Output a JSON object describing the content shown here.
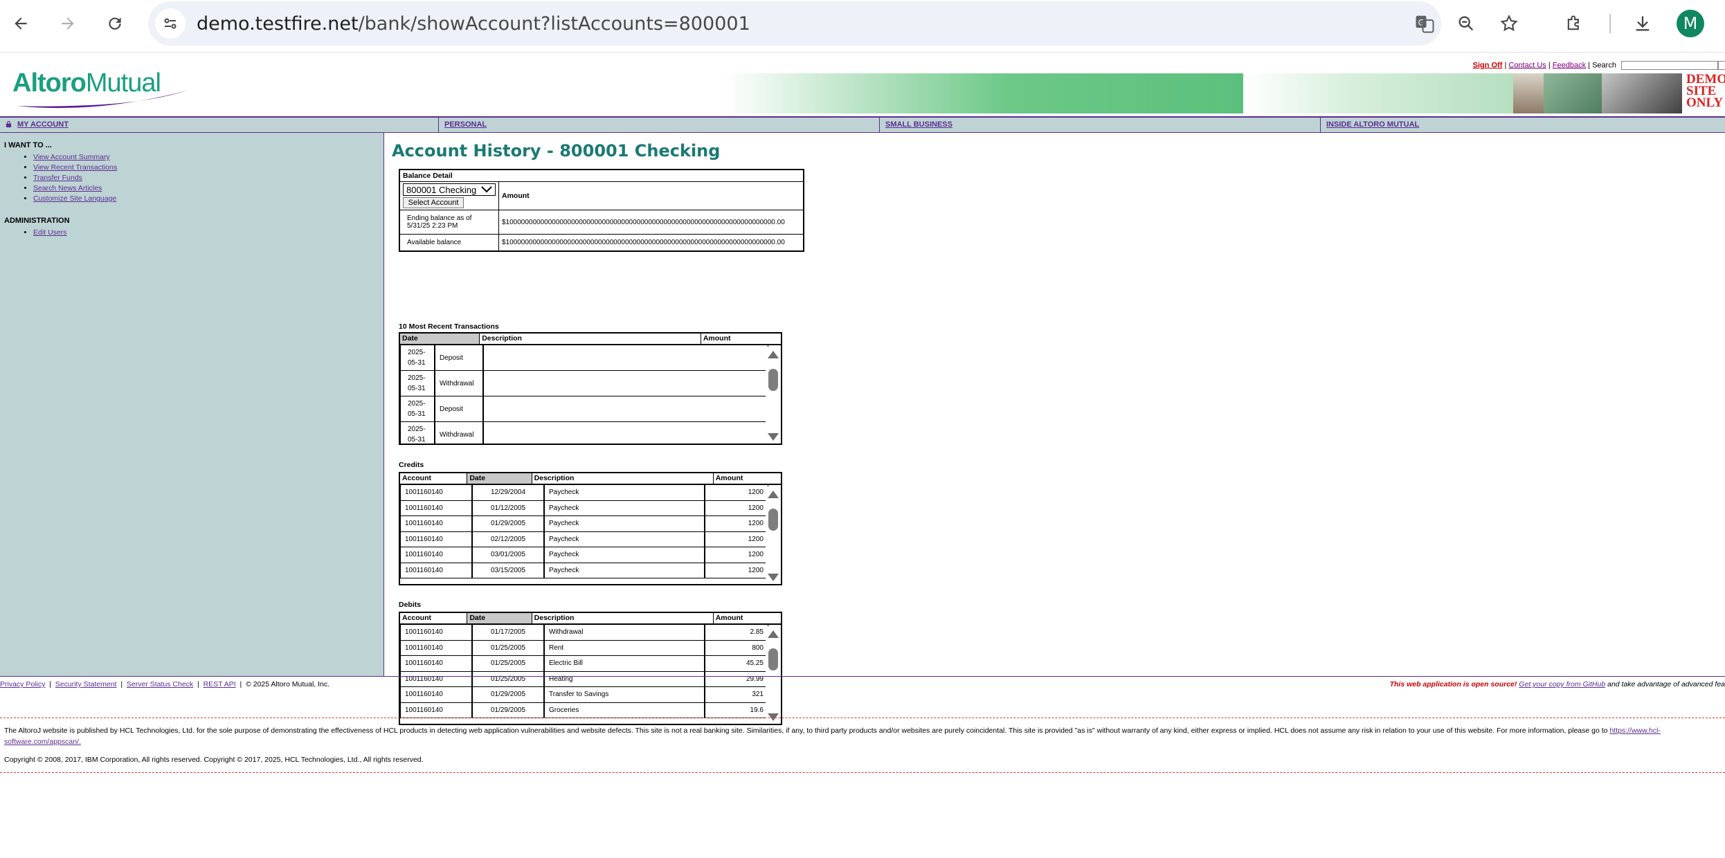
{
  "browser": {
    "url_domain": "demo.testfire.net",
    "url_path": "/bank/showAccount?listAccounts=800001",
    "profile_initial": "M",
    "icons": [
      "back-icon",
      "forward-icon",
      "reload-icon",
      "site-info-icon",
      "translate-icon",
      "zoom-icon",
      "star-icon",
      "extensions-icon",
      "download-icon"
    ]
  },
  "header": {
    "sign_off": "Sign Off",
    "contact_us": "Contact Us",
    "feedback": "Feedback",
    "search_label": "Search",
    "logo_bold": "Altoro",
    "logo_light": "Mutual",
    "demo_text": "DEMO SITE ONLY"
  },
  "tabs": [
    "MY ACCOUNT",
    "PERSONAL",
    "SMALL BUSINESS",
    "INSIDE ALTORO MUTUAL"
  ],
  "sidebar": {
    "i_want_heading": "I WANT TO ...",
    "i_want_items": [
      "View Account Summary",
      "View Recent Transactions",
      "Transfer Funds",
      "Search News Articles",
      "Customize Site Language"
    ],
    "admin_heading": "ADMINISTRATION",
    "admin_items": [
      "Edit Users"
    ]
  },
  "main": {
    "title": "Account History - 800001 Checking",
    "balance": {
      "caption": "Balance Detail",
      "selected_account": "800001 Checking",
      "select_button": "Select Account",
      "amount_header": "Amount",
      "ending_label": "Ending balance as of 5/31/25 2:23 PM",
      "ending_value": "$1000000000000000000000000000000000000000000000000000000000000000000000.00",
      "available_label": "Available balance",
      "available_value": "$1000000000000000000000000000000000000000000000000000000000000000000000.00"
    },
    "recent": {
      "caption": "10 Most Recent Transactions",
      "headers": [
        "Date",
        "Description",
        "Amount"
      ],
      "rows": [
        {
          "date": "2025-05-31",
          "desc": "Deposit",
          "amount": ""
        },
        {
          "date": "2025-05-31",
          "desc": "Withdrawal",
          "amount": ""
        },
        {
          "date": "2025-05-31",
          "desc": "Deposit",
          "amount": ""
        },
        {
          "date": "2025-05-31",
          "desc": "Withdrawal",
          "amount": ""
        }
      ]
    },
    "credits": {
      "caption": "Credits",
      "headers": [
        "Account",
        "Date",
        "Description",
        "Amount"
      ],
      "rows": [
        {
          "account": "1001160140",
          "date": "12/29/2004",
          "desc": "Paycheck",
          "amount": "1200"
        },
        {
          "account": "1001160140",
          "date": "01/12/2005",
          "desc": "Paycheck",
          "amount": "1200"
        },
        {
          "account": "1001160140",
          "date": "01/29/2005",
          "desc": "Paycheck",
          "amount": "1200"
        },
        {
          "account": "1001160140",
          "date": "02/12/2005",
          "desc": "Paycheck",
          "amount": "1200"
        },
        {
          "account": "1001160140",
          "date": "03/01/2005",
          "desc": "Paycheck",
          "amount": "1200"
        },
        {
          "account": "1001160140",
          "date": "03/15/2005",
          "desc": "Paycheck",
          "amount": "1200"
        }
      ]
    },
    "debits": {
      "caption": "Debits",
      "headers": [
        "Account",
        "Date",
        "Description",
        "Amount"
      ],
      "rows": [
        {
          "account": "1001160140",
          "date": "01/17/2005",
          "desc": "Withdrawal",
          "amount": "2.85"
        },
        {
          "account": "1001160140",
          "date": "01/25/2005",
          "desc": "Rent",
          "amount": "800"
        },
        {
          "account": "1001160140",
          "date": "01/25/2005",
          "desc": "Electric Bill",
          "amount": "45.25"
        },
        {
          "account": "1001160140",
          "date": "01/25/2005",
          "desc": "Heating",
          "amount": "29.99"
        },
        {
          "account": "1001160140",
          "date": "01/29/2005",
          "desc": "Transfer to Savings",
          "amount": "321"
        },
        {
          "account": "1001160140",
          "date": "01/29/2005",
          "desc": "Groceries",
          "amount": "19.6"
        }
      ]
    }
  },
  "footer": {
    "links": [
      "Privacy Policy",
      "Security Statement",
      "Server Status Check",
      "REST API"
    ],
    "copyright_short": "© 2025 Altoro Mutual, Inc.",
    "open_source": "This web application is open source!",
    "github_link": "Get your copy from GitHub",
    "tail": "and take advantage of advanced fea",
    "disclaimer": "The AltoroJ website is published by HCL Technologies, Ltd. for the sole purpose of demonstrating the effectiveness of HCL products in detecting web application vulnerabilities and website defects. This site is not a real banking site. Similarities, if any, to third party products and/or websites are purely coincidental. This site is provided \"as is\" without warranty of any kind, either express or implied. HCL does not assume any risk in relation to your use of this website. For more information, please go to",
    "disclaimer_link": "https://www.hcl-software.com/appscan/.",
    "copyright_long": "Copyright © 2008, 2017, IBM Corporation, All rights reserved. Copyright © 2017, 2025, HCL Technologies, Ltd., All rights reserved."
  },
  "colors": {
    "brand_teal": "#1a7a73",
    "link_purple": "#5b2d91",
    "sidebar_bg": "#bed3d4",
    "alert_red": "#cc0000"
  }
}
